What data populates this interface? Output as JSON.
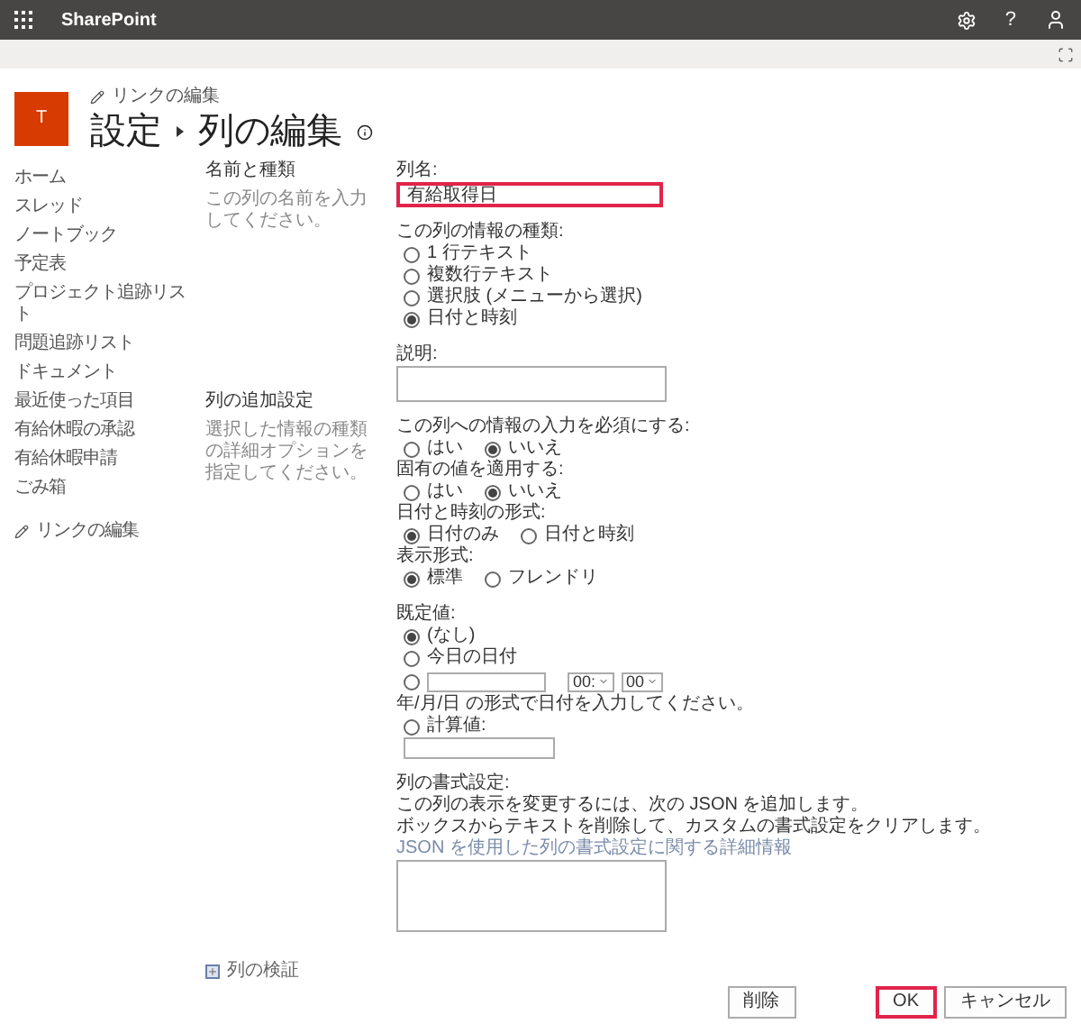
{
  "app_bar": {
    "title": "SharePoint",
    "help": "?"
  },
  "header": {
    "logo_letter": "T",
    "edit_links": "リンクの編集",
    "breadcrumb": [
      "設定",
      "列の編集"
    ]
  },
  "sidebar": {
    "items": [
      {
        "label": "ホーム"
      },
      {
        "label": "スレッド"
      },
      {
        "label": "ノートブック"
      },
      {
        "label": "予定表"
      },
      {
        "label": "プロジェクト追跡リスト"
      },
      {
        "label": "問題追跡リスト"
      },
      {
        "label": "ドキュメント"
      },
      {
        "label": "最近使った項目"
      },
      {
        "label": "有給休暇の承認"
      },
      {
        "label": "有給休暇申請"
      },
      {
        "label": "ごみ箱"
      }
    ],
    "edit_links": "リンクの編集"
  },
  "sections": [
    {
      "title": "名前と種類",
      "description": "この列の名前を入力してください。"
    },
    {
      "title": "列の追加設定",
      "description": "選択した情報の種類の詳細オプションを指定してください。"
    }
  ],
  "form": {
    "column_name": {
      "label": "列名:",
      "value": "有給取得日",
      "highlighted": true
    },
    "type": {
      "label": "この列の情報の種類:",
      "options": [
        {
          "label": "1 行テキスト",
          "selected": false
        },
        {
          "label": "複数行テキスト",
          "selected": false
        },
        {
          "label": "選択肢 (メニューから選択)",
          "selected": false
        },
        {
          "label": "日付と時刻",
          "selected": true
        }
      ]
    },
    "description": {
      "label": "説明:"
    },
    "choices": [
      {
        "label": "この列への情報の入力を必須にする:",
        "options": [
          {
            "label": "はい",
            "selected": false
          },
          {
            "label": "いいえ",
            "selected": true
          }
        ]
      },
      {
        "label": "固有の値を適用する:",
        "options": [
          {
            "label": "はい",
            "selected": false
          },
          {
            "label": "いいえ",
            "selected": true
          }
        ]
      },
      {
        "label": "日付と時刻の形式:",
        "options": [
          {
            "label": "日付のみ",
            "selected": true
          },
          {
            "label": "日付と時刻",
            "selected": false
          }
        ]
      },
      {
        "label": "表示形式:",
        "options": [
          {
            "label": "標準",
            "selected": true
          },
          {
            "label": "フレンドリ",
            "selected": false
          }
        ]
      }
    ],
    "default": {
      "label": "既定値:",
      "options": [
        {
          "kind": "text",
          "label": "(なし)",
          "selected": true
        },
        {
          "kind": "text",
          "label": "今日の日付",
          "selected": false
        },
        {
          "kind": "date",
          "selected": false,
          "hour": "00:",
          "minute": "00"
        }
      ],
      "hint": "年/月/日 の形式で日付を入力してください。",
      "calculated": {
        "label": "計算値:",
        "selected": false
      }
    },
    "formatting": {
      "label": "列の書式設定:",
      "lines": [
        "この列の表示を変更するには、次の JSON を追加します。",
        "ボックスからテキストを削除して、カスタムの書式設定をクリアします。"
      ],
      "link": "JSON を使用した列の書式設定に関する詳細情報"
    }
  },
  "validation": {
    "label": "列の検証",
    "expanded": false
  },
  "buttons": [
    {
      "label": "削除",
      "kind": "delete",
      "highlighted": false
    },
    {
      "label": "OK",
      "kind": "primary",
      "highlighted": true
    },
    {
      "label": "キャンセル",
      "kind": "cancel",
      "highlighted": false
    }
  ]
}
